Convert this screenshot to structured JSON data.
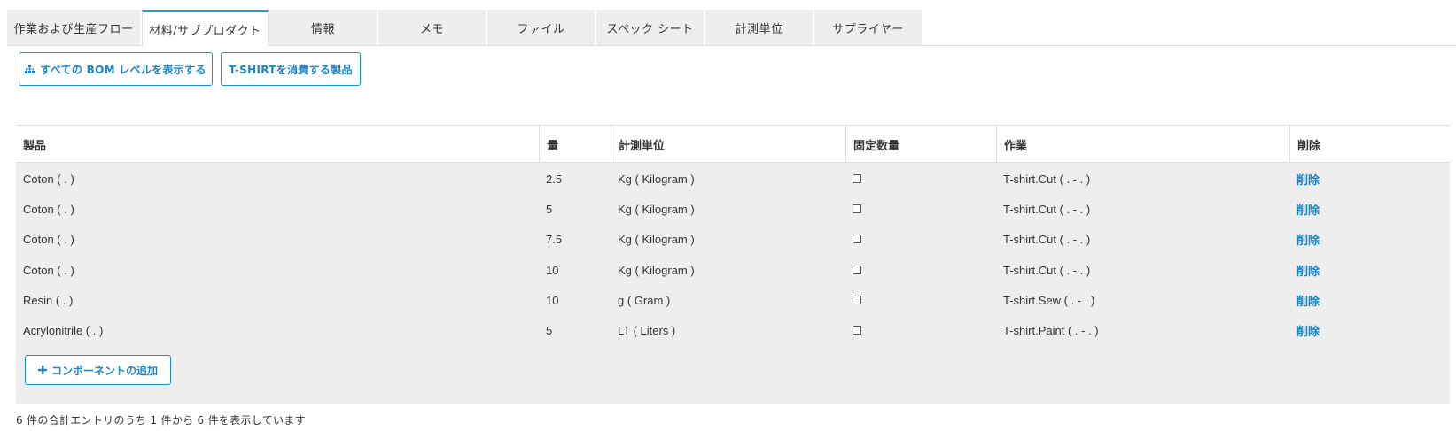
{
  "tabs": [
    {
      "label": "作業および生産フロー",
      "active": false
    },
    {
      "label": "材料/サブプロダクト",
      "active": true
    },
    {
      "label": "情報",
      "active": false
    },
    {
      "label": "メモ",
      "active": false
    },
    {
      "label": "ファイル",
      "active": false
    },
    {
      "label": "スペック シート",
      "active": false
    },
    {
      "label": "計測単位",
      "active": false
    },
    {
      "label": "サプライヤー",
      "active": false
    }
  ],
  "actions": {
    "show_bom_label": "すべての BOM レベルを表示する",
    "consuming_label": "T-SHIRTを消費する製品"
  },
  "table": {
    "headers": [
      "製品",
      "量",
      "計測単位",
      "固定数量",
      "作業",
      "削除"
    ],
    "rows": [
      {
        "product": "Coton ( . )",
        "qty": "2.5",
        "unit": "Kg ( Kilogram )",
        "fixed": false,
        "operation": "T-shirt.Cut ( . - . )",
        "delete": "削除"
      },
      {
        "product": "Coton ( . )",
        "qty": "5",
        "unit": "Kg ( Kilogram )",
        "fixed": false,
        "operation": "T-shirt.Cut ( . - . )",
        "delete": "削除"
      },
      {
        "product": "Coton ( . )",
        "qty": "7.5",
        "unit": "Kg ( Kilogram )",
        "fixed": false,
        "operation": "T-shirt.Cut ( . - . )",
        "delete": "削除"
      },
      {
        "product": "Coton ( . )",
        "qty": "10",
        "unit": "Kg ( Kilogram )",
        "fixed": false,
        "operation": "T-shirt.Cut ( . - . )",
        "delete": "削除"
      },
      {
        "product": "Resin ( . )",
        "qty": "10",
        "unit": "g ( Gram )",
        "fixed": false,
        "operation": "T-shirt.Sew ( . - . )",
        "delete": "削除"
      },
      {
        "product": "Acrylonitrile ( . )",
        "qty": "5",
        "unit": "LT ( Liters )",
        "fixed": false,
        "operation": "T-shirt.Paint ( . - . )",
        "delete": "削除"
      }
    ],
    "add_label": "コンポーネントの追加"
  },
  "footer": {
    "summary": "6 件の合計エントリのうち 1 件から 6 件を表示しています"
  },
  "colors": {
    "accent": "#1a84c4",
    "tab_active_border": "#2c9cd6",
    "row_bg": "#eeeeee"
  },
  "icons": {
    "bom": "sitemap-icon",
    "add": "plus-icon"
  }
}
